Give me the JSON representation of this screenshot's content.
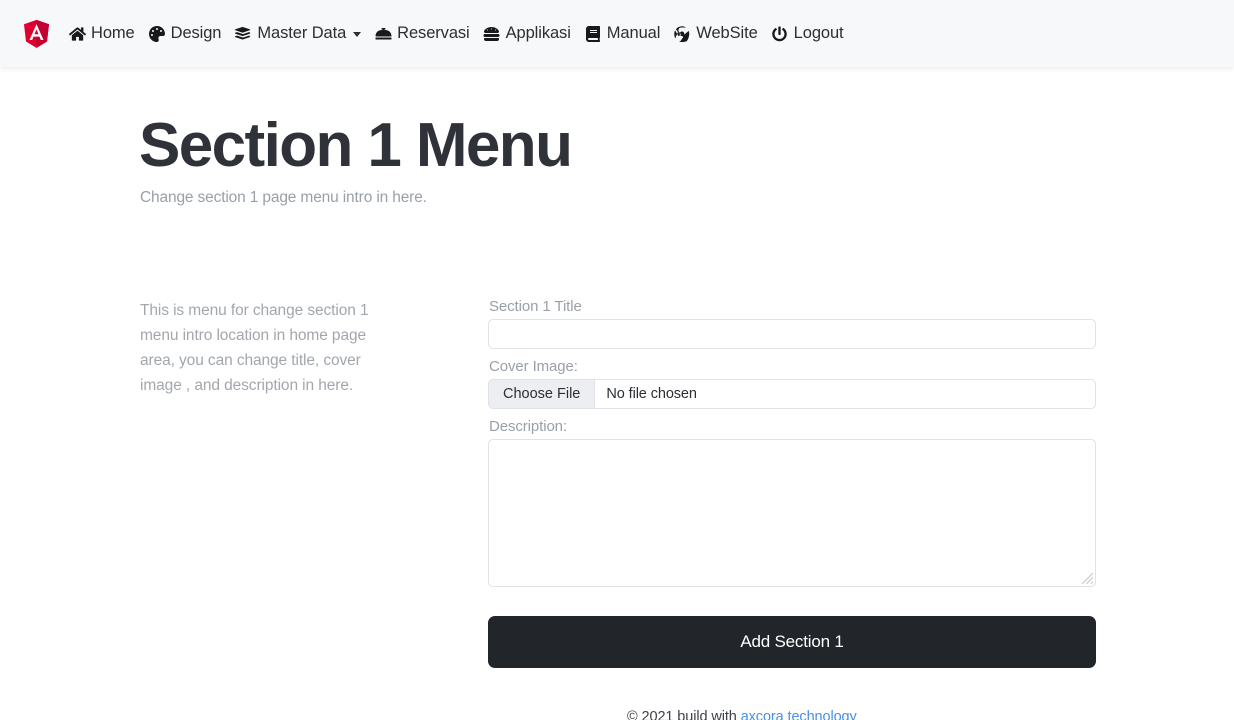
{
  "navbar": {
    "brand": {
      "icon": "angular-shield-logo",
      "color": "#dd0031"
    },
    "items": [
      {
        "label": "Home",
        "icon": "home-icon",
        "has_caret": false
      },
      {
        "label": "Design",
        "icon": "palette-icon",
        "has_caret": false
      },
      {
        "label": "Master Data",
        "icon": "database-icon",
        "has_caret": true
      },
      {
        "label": "Reservasi",
        "icon": "concierge-bell-icon",
        "has_caret": false
      },
      {
        "label": "Applikasi",
        "icon": "hamburger-food-icon",
        "has_caret": false
      },
      {
        "label": "Manual",
        "icon": "book-icon",
        "has_caret": false
      },
      {
        "label": "WebSite",
        "icon": "chrome-globe-icon",
        "has_caret": false
      },
      {
        "label": "Logout",
        "icon": "power-icon",
        "has_caret": false
      }
    ]
  },
  "header": {
    "title": "Section 1 Menu",
    "subtitle": "Change section 1 page menu intro in here."
  },
  "intro": {
    "text": "This is menu for change section 1 menu intro location in home page area, you can change title, cover image , and description in here."
  },
  "form": {
    "title_label": "Section 1 Title",
    "title_value": "",
    "title_placeholder": "",
    "cover_label": "Cover Image:",
    "cover_button": "Choose File",
    "cover_filename": "No file chosen",
    "description_label": "Description:",
    "description_value": "",
    "description_placeholder": "",
    "submit_label": "Add Section 1"
  },
  "footer": {
    "text": "© 2021 build with ",
    "link_label": "axcora technology"
  },
  "colors": {
    "navbar_bg": "#f7f8fa",
    "brand_red": "#dd0031",
    "button_dark": "#22262a",
    "link_blue": "#4a90e2",
    "muted_text": "#9aa0a8"
  }
}
